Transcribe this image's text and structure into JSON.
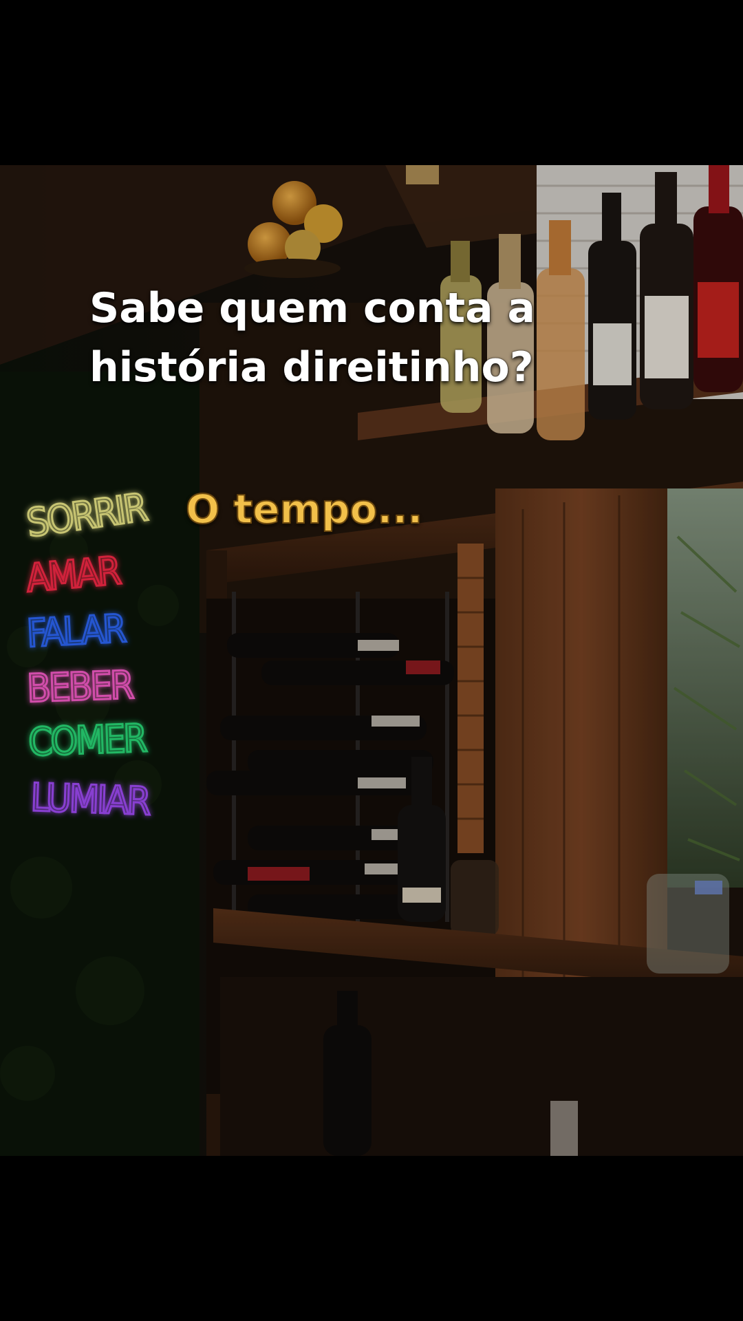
{
  "caption": {
    "line1": "Sabe quem conta a",
    "line2": "história direitinho?",
    "highlight": "O tempo..."
  },
  "neon_sign": {
    "words": [
      {
        "text": "SORRIR",
        "color": "#f3f08c"
      },
      {
        "text": "AMAR",
        "color": "#ff2a4a"
      },
      {
        "text": "FALAR",
        "color": "#2f6bff"
      },
      {
        "text": "BEBER",
        "color": "#ff5fd0"
      },
      {
        "text": "COMER",
        "color": "#29e07a"
      },
      {
        "text": "LUMIAR",
        "color": "#a64dff"
      }
    ]
  },
  "colors": {
    "caption_text": "#ffffff",
    "highlight_text": "#f2c04a",
    "wood": "#4a2a16",
    "background": "#000000"
  }
}
